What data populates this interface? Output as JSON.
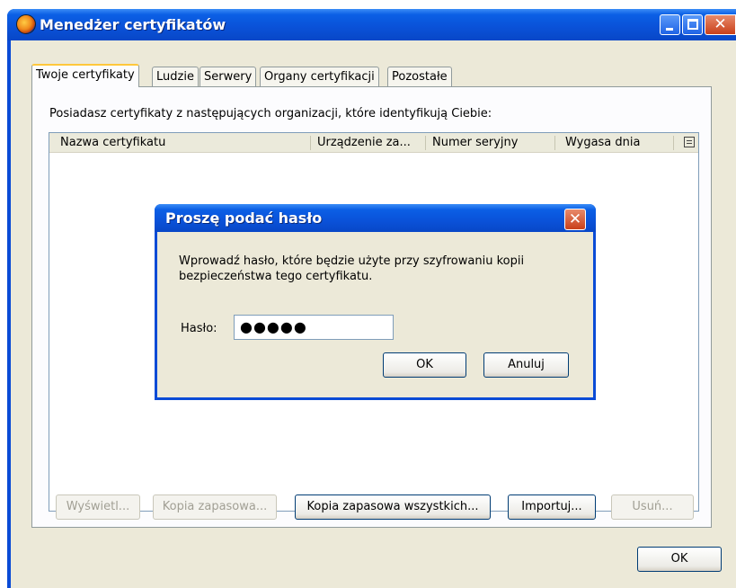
{
  "window": {
    "title": "Menedżer certyfikatów",
    "controls": {
      "minimize_icon": "minimize-icon",
      "maximize_icon": "maximize-icon",
      "close_icon": "close-icon",
      "close_glyph": "✕"
    }
  },
  "tabs": [
    {
      "label": "Twoje certyfikaty",
      "active": true
    },
    {
      "label": "Ludzie",
      "active": false
    },
    {
      "label": "Serwery",
      "active": false
    },
    {
      "label": "Organy certyfikacji",
      "active": false
    },
    {
      "label": "Pozostałe",
      "active": false
    }
  ],
  "panel": {
    "description": "Posiadasz certyfikaty z następujących organizacji, które identyfikują Ciebie:",
    "columns": [
      "Nazwa certyfikatu",
      "Urządzenie za...",
      "Numer seryjny",
      "Wygasa dnia"
    ],
    "column_picker_icon": "column-picker-icon",
    "rows": []
  },
  "buttons": {
    "view": {
      "label": "Wyświetl...",
      "enabled": false
    },
    "backup": {
      "label": "Kopia zapasowa...",
      "enabled": false
    },
    "backup_all": {
      "label": "Kopia zapasowa wszystkich...",
      "enabled": true
    },
    "import": {
      "label": "Importuj...",
      "enabled": true
    },
    "delete": {
      "label": "Usuń...",
      "enabled": false
    }
  },
  "footer": {
    "ok_label": "OK"
  },
  "dialog": {
    "title": "Proszę podać hasło",
    "message": "Wprowadź hasło, które będzie użyte przy szyfrowaniu kopii bezpieczeństwa tego certyfikatu.",
    "password_label": "Hasło:",
    "password_value": "●●●●●",
    "ok_label": "OK",
    "cancel_label": "Anuluj",
    "close_glyph": "✕"
  },
  "colors": {
    "titlebar": "#0a52d9",
    "dialog_face": "#ece9d8",
    "accent_tab": "#ffc83c"
  }
}
